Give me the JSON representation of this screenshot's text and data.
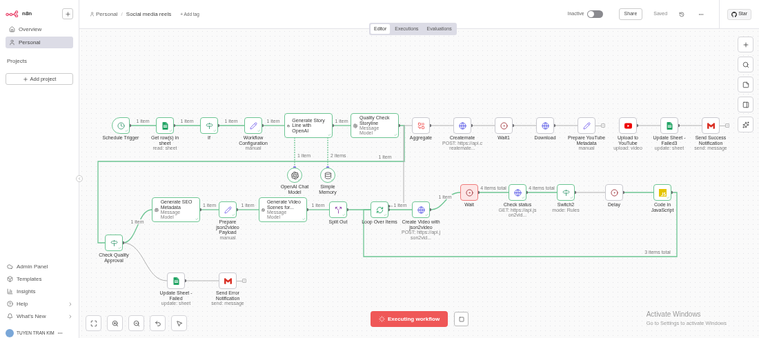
{
  "sidebar": {
    "logo": "n8n",
    "nav": [
      {
        "label": "Overview",
        "selected": false
      },
      {
        "label": "Personal",
        "selected": true
      }
    ],
    "projects_heading": "Projects",
    "add_project": "Add project",
    "bottom_nav": [
      {
        "label": "Admin Panel",
        "submenu": false
      },
      {
        "label": "Templates",
        "submenu": false
      },
      {
        "label": "Insights",
        "submenu": false
      },
      {
        "label": "Help",
        "submenu": true
      },
      {
        "label": "What's New",
        "submenu": true
      }
    ],
    "user": "TUYEN TRAN KIM"
  },
  "header": {
    "breadcrumb": [
      "Personal",
      "Social media reels"
    ],
    "separator": "/",
    "add_tag": "+ Add tag",
    "active_label": "Inactive",
    "active": false,
    "share": "Share",
    "save_state": "Saved",
    "star": "Star"
  },
  "tabs": [
    {
      "label": "Editor",
      "selected": true
    },
    {
      "label": "Executions",
      "selected": false
    },
    {
      "label": "Evaluations",
      "selected": false
    }
  ],
  "nodes": [
    {
      "label": "Schedule Trigger",
      "kind": "clock",
      "success": true,
      "running": false
    },
    {
      "label": "Get row(s) in sheet",
      "subtitle": "read: sheet",
      "kind": "sheet",
      "success": true,
      "running": false
    },
    {
      "label": "If",
      "kind": "signpost",
      "success": true,
      "running": false
    },
    {
      "label": "Workflow Configuration",
      "subtitle": "manual",
      "kind": "pencil",
      "success": true,
      "running": false
    },
    {
      "label": "Generate Story Line with OpenAI",
      "kind": "bot",
      "success": true,
      "running": false
    },
    {
      "label": "Quality Check Storyline",
      "subtitle": "Message Model",
      "kind": "openai",
      "success": true,
      "running": false
    },
    {
      "label": "Aggregate",
      "kind": "aggregate",
      "success": false,
      "running": false
    },
    {
      "label": "Createmate",
      "subtitle": "POST: https://api.createmate...",
      "kind": "globe",
      "success": false,
      "running": false
    },
    {
      "label": "Wait1",
      "kind": "wait",
      "success": false,
      "running": false
    },
    {
      "label": "Download",
      "kind": "globe",
      "success": false,
      "running": false
    },
    {
      "label": "Prepare YouTube Metadata",
      "subtitle": "manual",
      "kind": "pencil",
      "success": false,
      "running": false,
      "open_end": true
    },
    {
      "label": "Upload to YouTube",
      "subtitle": "upload: video",
      "kind": "youtube",
      "success": false,
      "running": false
    },
    {
      "label": "Update Sheet - Failed3",
      "subtitle": "update: sheet",
      "kind": "sheet",
      "success": false,
      "running": false
    },
    {
      "label": "Send Success Notification",
      "subtitle": "send: message",
      "kind": "gmail",
      "success": false,
      "running": false,
      "open_end": true
    },
    {
      "label": "OpenAI Chat Model",
      "kind": "openai",
      "success": true,
      "running": false
    },
    {
      "label": "Simple Memory",
      "kind": "memory",
      "success": true,
      "running": false
    },
    {
      "label": "Check Quality Approval",
      "kind": "signpost",
      "success": true,
      "running": false
    },
    {
      "label": "Generate SEO Metadata",
      "subtitle": "Message Model",
      "kind": "openai",
      "success": true,
      "running": false
    },
    {
      "label": "Prepare json2video Payload",
      "subtitle": "manual",
      "kind": "pencil",
      "success": true,
      "running": false
    },
    {
      "label": "Generate Video Scenes for...",
      "subtitle": "Message Model",
      "kind": "openai",
      "success": true,
      "running": false
    },
    {
      "label": "Split Out",
      "kind": "split",
      "success": true,
      "running": false
    },
    {
      "label": "Loop Over Items",
      "kind": "loop",
      "success": true,
      "running": false
    },
    {
      "label": "Create Video with json2video",
      "subtitle": "POST: https://api.json2vid...",
      "kind": "globe",
      "success": true,
      "running": false
    },
    {
      "label": "Wait",
      "kind": "wait",
      "success": false,
      "running": true
    },
    {
      "label": "Check status",
      "subtitle": "GET: https://api.json2vid...",
      "kind": "globe",
      "success": true,
      "running": false
    },
    {
      "label": "Switch2",
      "subtitle": "mode: Rules",
      "kind": "signpost",
      "success": true,
      "running": false
    },
    {
      "label": "Delay",
      "kind": "wait",
      "success": false,
      "running": false
    },
    {
      "label": "Code in JavaScript",
      "kind": "js",
      "success": true,
      "running": false
    },
    {
      "label": "Update Sheet - Failed",
      "subtitle": "update: sheet",
      "kind": "sheet",
      "success": false,
      "running": false
    },
    {
      "label": "Send Error Notification",
      "subtitle": "send: message",
      "kind": "gmail",
      "success": false,
      "running": false,
      "open_end": true
    }
  ],
  "edges": [
    {
      "label": "1 item",
      "active": true
    },
    {
      "label": "1 item",
      "active": true
    },
    {
      "label": "1 item",
      "active": true
    },
    {
      "label": "1 item",
      "active": true
    },
    {
      "label": "1 item",
      "active": true
    },
    {
      "label": "1 item",
      "active": true
    },
    {
      "active": false
    },
    {
      "active": false
    },
    {
      "active": false
    },
    {
      "active": false
    },
    {
      "active": false
    },
    {
      "active": false
    },
    {
      "label": "1 item",
      "active": true
    },
    {
      "label": "2 items",
      "active": true
    },
    {
      "label": "1 item",
      "active": true
    },
    {
      "active": false
    },
    {
      "active": false
    },
    {
      "label": "1 item",
      "active": true
    },
    {
      "label": "1 item",
      "active": true
    },
    {
      "label": "1 item",
      "active": true
    },
    {
      "active": true
    },
    {
      "active": false
    },
    {
      "label": "1 item",
      "active": true
    },
    {
      "label": "1 item",
      "active": true
    },
    {
      "label": "4 items total",
      "active": true
    },
    {
      "label": "4 items total",
      "active": true
    },
    {
      "active": false
    },
    {
      "active": true
    },
    {
      "label": "3 items total",
      "active": true
    }
  ],
  "executing_label": "Executing workflow",
  "os_notice": {
    "title": "Activate Windows",
    "text": "Go to Settings to activate Windows"
  }
}
